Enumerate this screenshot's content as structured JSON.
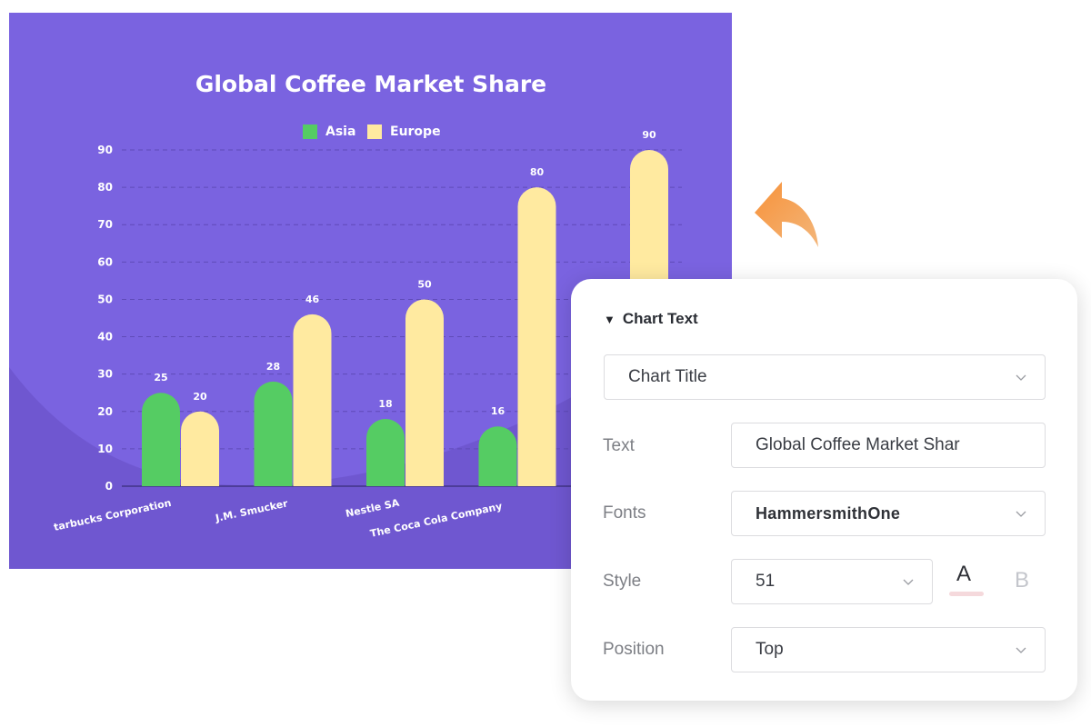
{
  "chart_data": {
    "type": "bar",
    "title": "Global Coffee Market Share",
    "categories": [
      "Starbucks Corporation",
      "J.M. Smucker",
      "Nestle SA",
      "The Coca Cola Company",
      ""
    ],
    "visible_category_labels": [
      "tarbucks Corporation",
      "J.M. Smucker",
      "Nestle SA",
      "The Coca Cola Company"
    ],
    "series": [
      {
        "name": "Asia",
        "color": "#55cc63",
        "values": [
          25,
          28,
          18,
          16,
          null
        ]
      },
      {
        "name": "Europe",
        "color": "#ffeaa0",
        "values": [
          20,
          46,
          50,
          80,
          90
        ]
      }
    ],
    "ylim": [
      0,
      90
    ],
    "yticks": [
      0,
      10,
      20,
      30,
      40,
      50,
      60,
      70,
      80,
      90
    ],
    "xlabel": "",
    "ylabel": "",
    "grid": true,
    "legend_position": "top-center",
    "background": "#7a63e0"
  },
  "panel": {
    "section_title": "Chart Text",
    "element_select": "Chart Title",
    "rows": {
      "text_label": "Text",
      "text_value": "Global Coffee Market Shar",
      "fonts_label": "Fonts",
      "fonts_value": "HammersmithOne",
      "style_label": "Style",
      "style_value": "51",
      "font_color_button": "A",
      "bold_button": "B",
      "position_label": "Position",
      "position_value": "Top"
    }
  },
  "icons": {
    "arrow": "curved-arrow-icon",
    "chevron": "chevron-down-icon",
    "collapse": "triangle-down-icon"
  },
  "colors": {
    "arrow_start": "#f7923a",
    "arrow_end": "#f3b67a",
    "font_color_underline": "#f5d9dc"
  }
}
